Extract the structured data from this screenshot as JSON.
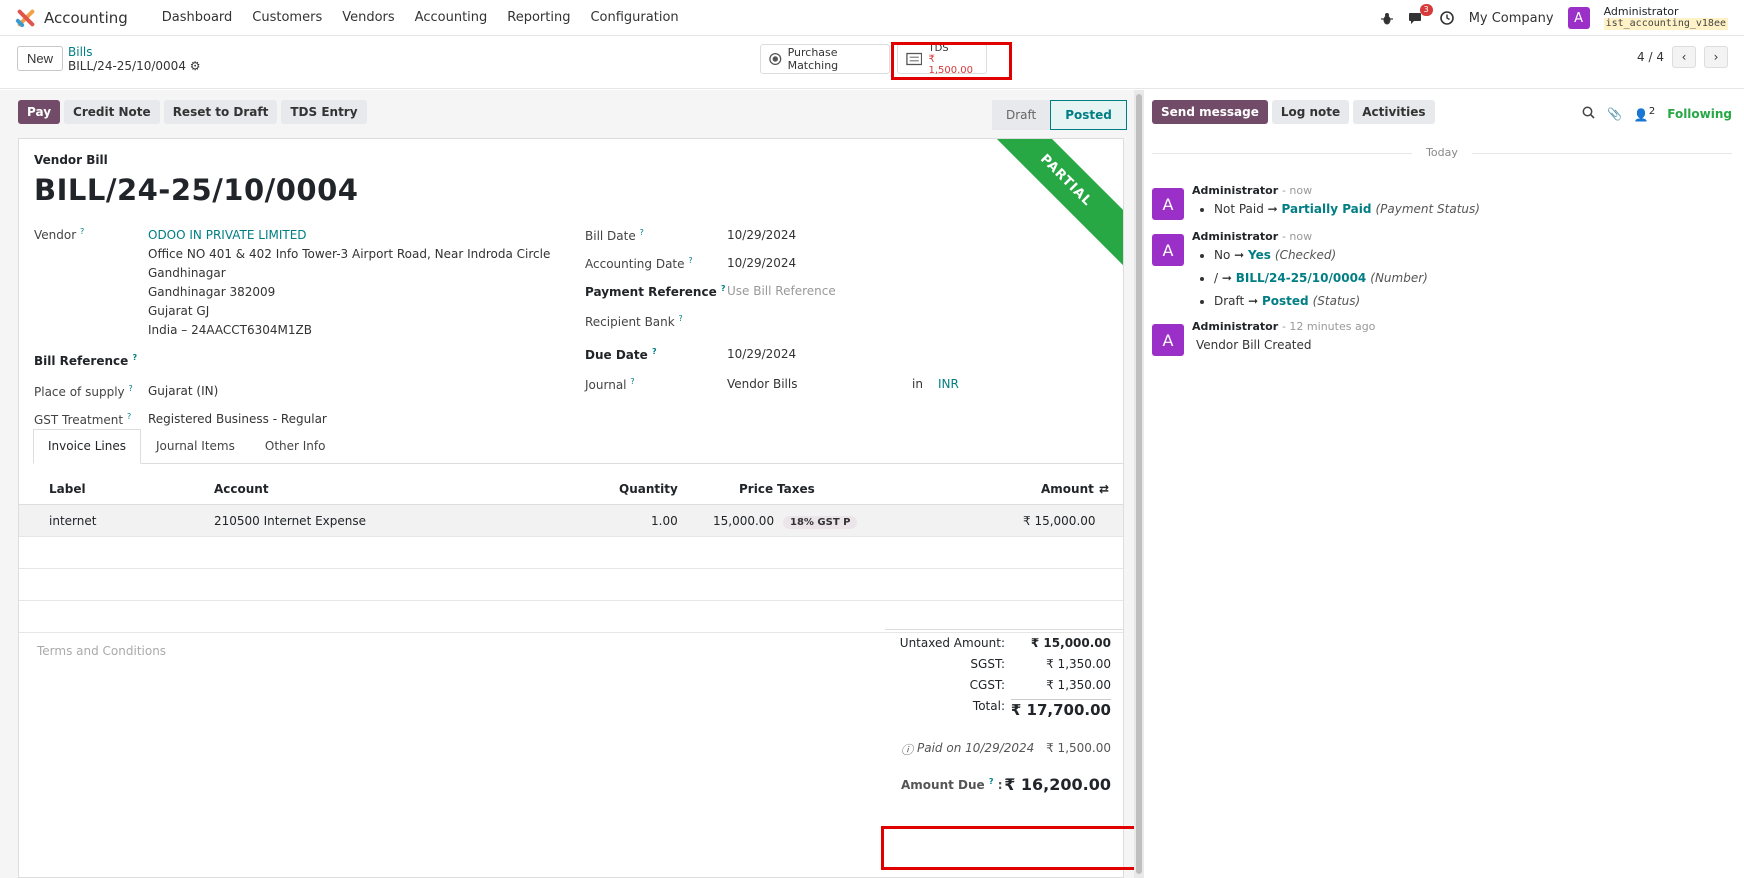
{
  "navbar": {
    "app_name": "Accounting",
    "menu": [
      "Dashboard",
      "Customers",
      "Vendors",
      "Accounting",
      "Reporting",
      "Configuration"
    ],
    "message_count": "3",
    "company": "My Company",
    "user_initial": "A",
    "user_name": "Administrator",
    "db_name": "ist_accounting_v18ee"
  },
  "control": {
    "new_label": "New",
    "breadcrumb_parent": "Bills",
    "breadcrumb_current": "BILL/24-25/10/0004",
    "purchase_matching": "Purchase Matching",
    "tds_label": "TDS",
    "tds_amount": "₹ 1,500.00",
    "pager": "4 / 4"
  },
  "actions": {
    "pay": "Pay",
    "credit_note": "Credit Note",
    "reset_to_draft": "Reset to Draft",
    "tds_entry": "TDS Entry",
    "status_draft": "Draft",
    "status_posted": "Posted"
  },
  "form": {
    "ribbon": "PARTIAL",
    "doc_type": "Vendor Bill",
    "title": "BILL/24-25/10/0004",
    "vendor_label": "Vendor",
    "vendor_name": "ODOO IN PRIVATE LIMITED",
    "vendor_address": [
      "Office NO 401 & 402 Info Tower-3 Airport Road, Near Indroda Circle",
      "Gandhinagar",
      "Gandhinagar 382009",
      "Gujarat GJ",
      "India – 24AACCT6304M1ZB"
    ],
    "bill_reference_label": "Bill Reference",
    "place_of_supply_label": "Place of supply",
    "place_of_supply": "Gujarat (IN)",
    "gst_treatment_label": "GST Treatment",
    "gst_treatment": "Registered Business - Regular",
    "bill_date_label": "Bill Date",
    "bill_date": "10/29/2024",
    "accounting_date_label": "Accounting Date",
    "accounting_date": "10/29/2024",
    "payment_reference_label": "Payment Reference",
    "payment_reference_placeholder": "Use Bill Reference",
    "recipient_bank_label": "Recipient Bank",
    "due_date_label": "Due Date",
    "due_date": "10/29/2024",
    "journal_label": "Journal",
    "journal": "Vendor Bills",
    "in_label": "in",
    "currency": "INR"
  },
  "tabs": [
    "Invoice Lines",
    "Journal Items",
    "Other Info"
  ],
  "lines": {
    "headers": {
      "label": "Label",
      "account": "Account",
      "quantity": "Quantity",
      "price": "Price",
      "taxes": "Taxes",
      "amount": "Amount"
    },
    "rows": [
      {
        "label": "internet",
        "account": "210500 Internet Expense",
        "quantity": "1.00",
        "price": "15,000.00",
        "tax": "18% GST P",
        "amount": "₹ 15,000.00"
      }
    ]
  },
  "terms_placeholder": "Terms and Conditions",
  "totals": {
    "untaxed_label": "Untaxed Amount:",
    "untaxed": "₹ 15,000.00",
    "sgst_label": "SGST:",
    "sgst": "₹ 1,350.00",
    "cgst_label": "CGST:",
    "cgst": "₹ 1,350.00",
    "total_label": "Total:",
    "total": "₹ 17,700.00",
    "paid_label": "Paid on 10/29/2024",
    "paid": "₹ 1,500.00",
    "amount_due_label": "Amount Due",
    "amount_due": "₹ 16,200.00"
  },
  "chatter": {
    "send_message": "Send message",
    "log_note": "Log note",
    "activities": "Activities",
    "follower_count": "2",
    "following": "Following",
    "today": "Today",
    "messages": [
      {
        "author": "Administrator",
        "time": "- now",
        "lines": [
          {
            "old": "Not Paid",
            "new": "Partially Paid",
            "field": "(Payment Status)"
          }
        ]
      },
      {
        "author": "Administrator",
        "time": "- now",
        "lines": [
          {
            "old": "No",
            "new": "Yes",
            "field": "(Checked)"
          },
          {
            "old": "/",
            "new": "BILL/24-25/10/0004",
            "field": "(Number)"
          },
          {
            "old": "Draft",
            "new": "Posted",
            "field": "(Status)"
          }
        ]
      },
      {
        "author": "Administrator",
        "time": "- 12 minutes ago",
        "body": "Vendor Bill Created"
      }
    ]
  },
  "colors": {
    "brand": "#714b67",
    "teal": "#017e84",
    "ribbon": "#28a745",
    "highlight": "#e00000"
  }
}
